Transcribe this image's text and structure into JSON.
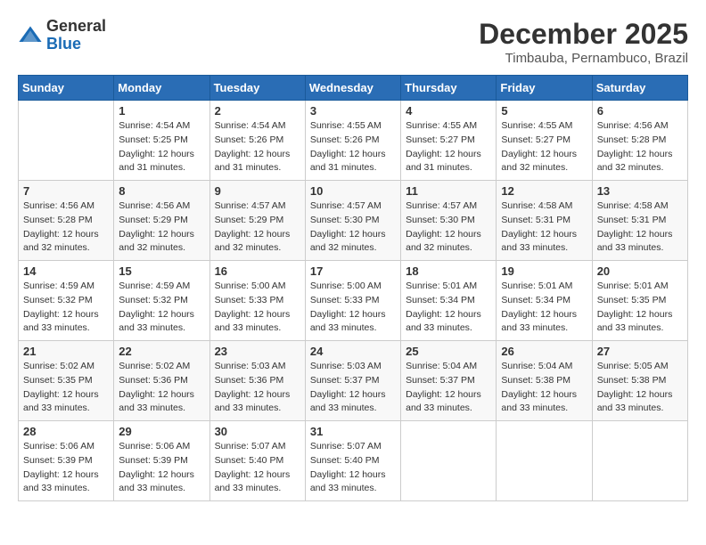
{
  "header": {
    "logo_general": "General",
    "logo_blue": "Blue",
    "month_title": "December 2025",
    "location": "Timbauba, Pernambuco, Brazil"
  },
  "days_of_week": [
    "Sunday",
    "Monday",
    "Tuesday",
    "Wednesday",
    "Thursday",
    "Friday",
    "Saturday"
  ],
  "weeks": [
    [
      {
        "day": "",
        "info": ""
      },
      {
        "day": "1",
        "info": "Sunrise: 4:54 AM\nSunset: 5:25 PM\nDaylight: 12 hours\nand 31 minutes."
      },
      {
        "day": "2",
        "info": "Sunrise: 4:54 AM\nSunset: 5:26 PM\nDaylight: 12 hours\nand 31 minutes."
      },
      {
        "day": "3",
        "info": "Sunrise: 4:55 AM\nSunset: 5:26 PM\nDaylight: 12 hours\nand 31 minutes."
      },
      {
        "day": "4",
        "info": "Sunrise: 4:55 AM\nSunset: 5:27 PM\nDaylight: 12 hours\nand 31 minutes."
      },
      {
        "day": "5",
        "info": "Sunrise: 4:55 AM\nSunset: 5:27 PM\nDaylight: 12 hours\nand 32 minutes."
      },
      {
        "day": "6",
        "info": "Sunrise: 4:56 AM\nSunset: 5:28 PM\nDaylight: 12 hours\nand 32 minutes."
      }
    ],
    [
      {
        "day": "7",
        "info": "Sunrise: 4:56 AM\nSunset: 5:28 PM\nDaylight: 12 hours\nand 32 minutes."
      },
      {
        "day": "8",
        "info": "Sunrise: 4:56 AM\nSunset: 5:29 PM\nDaylight: 12 hours\nand 32 minutes."
      },
      {
        "day": "9",
        "info": "Sunrise: 4:57 AM\nSunset: 5:29 PM\nDaylight: 12 hours\nand 32 minutes."
      },
      {
        "day": "10",
        "info": "Sunrise: 4:57 AM\nSunset: 5:30 PM\nDaylight: 12 hours\nand 32 minutes."
      },
      {
        "day": "11",
        "info": "Sunrise: 4:57 AM\nSunset: 5:30 PM\nDaylight: 12 hours\nand 32 minutes."
      },
      {
        "day": "12",
        "info": "Sunrise: 4:58 AM\nSunset: 5:31 PM\nDaylight: 12 hours\nand 33 minutes."
      },
      {
        "day": "13",
        "info": "Sunrise: 4:58 AM\nSunset: 5:31 PM\nDaylight: 12 hours\nand 33 minutes."
      }
    ],
    [
      {
        "day": "14",
        "info": "Sunrise: 4:59 AM\nSunset: 5:32 PM\nDaylight: 12 hours\nand 33 minutes."
      },
      {
        "day": "15",
        "info": "Sunrise: 4:59 AM\nSunset: 5:32 PM\nDaylight: 12 hours\nand 33 minutes."
      },
      {
        "day": "16",
        "info": "Sunrise: 5:00 AM\nSunset: 5:33 PM\nDaylight: 12 hours\nand 33 minutes."
      },
      {
        "day": "17",
        "info": "Sunrise: 5:00 AM\nSunset: 5:33 PM\nDaylight: 12 hours\nand 33 minutes."
      },
      {
        "day": "18",
        "info": "Sunrise: 5:01 AM\nSunset: 5:34 PM\nDaylight: 12 hours\nand 33 minutes."
      },
      {
        "day": "19",
        "info": "Sunrise: 5:01 AM\nSunset: 5:34 PM\nDaylight: 12 hours\nand 33 minutes."
      },
      {
        "day": "20",
        "info": "Sunrise: 5:01 AM\nSunset: 5:35 PM\nDaylight: 12 hours\nand 33 minutes."
      }
    ],
    [
      {
        "day": "21",
        "info": "Sunrise: 5:02 AM\nSunset: 5:35 PM\nDaylight: 12 hours\nand 33 minutes."
      },
      {
        "day": "22",
        "info": "Sunrise: 5:02 AM\nSunset: 5:36 PM\nDaylight: 12 hours\nand 33 minutes."
      },
      {
        "day": "23",
        "info": "Sunrise: 5:03 AM\nSunset: 5:36 PM\nDaylight: 12 hours\nand 33 minutes."
      },
      {
        "day": "24",
        "info": "Sunrise: 5:03 AM\nSunset: 5:37 PM\nDaylight: 12 hours\nand 33 minutes."
      },
      {
        "day": "25",
        "info": "Sunrise: 5:04 AM\nSunset: 5:37 PM\nDaylight: 12 hours\nand 33 minutes."
      },
      {
        "day": "26",
        "info": "Sunrise: 5:04 AM\nSunset: 5:38 PM\nDaylight: 12 hours\nand 33 minutes."
      },
      {
        "day": "27",
        "info": "Sunrise: 5:05 AM\nSunset: 5:38 PM\nDaylight: 12 hours\nand 33 minutes."
      }
    ],
    [
      {
        "day": "28",
        "info": "Sunrise: 5:06 AM\nSunset: 5:39 PM\nDaylight: 12 hours\nand 33 minutes."
      },
      {
        "day": "29",
        "info": "Sunrise: 5:06 AM\nSunset: 5:39 PM\nDaylight: 12 hours\nand 33 minutes."
      },
      {
        "day": "30",
        "info": "Sunrise: 5:07 AM\nSunset: 5:40 PM\nDaylight: 12 hours\nand 33 minutes."
      },
      {
        "day": "31",
        "info": "Sunrise: 5:07 AM\nSunset: 5:40 PM\nDaylight: 12 hours\nand 33 minutes."
      },
      {
        "day": "",
        "info": ""
      },
      {
        "day": "",
        "info": ""
      },
      {
        "day": "",
        "info": ""
      }
    ]
  ]
}
